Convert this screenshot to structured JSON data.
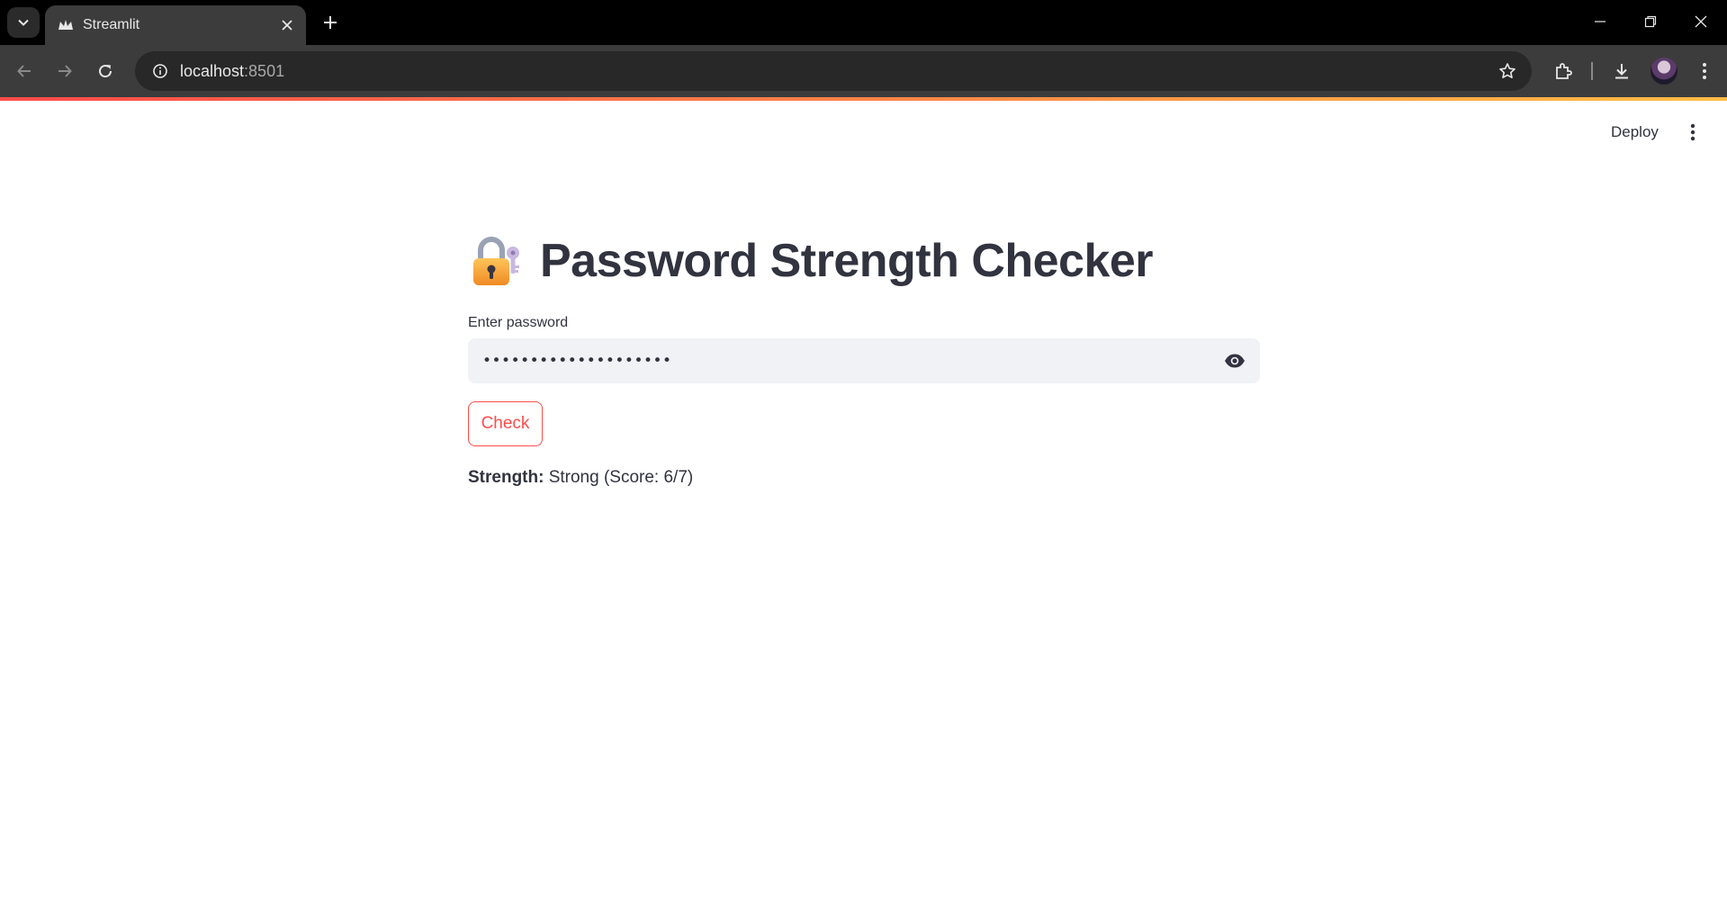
{
  "browser": {
    "tab_title": "Streamlit",
    "url_host": "localhost",
    "url_port": ":8501"
  },
  "icons": {
    "tab_search": "chevron-down-icon",
    "favicon": "streamlit-crown-icon",
    "tab_close": "close-icon",
    "new_tab": "plus-icon",
    "back": "arrow-left-icon",
    "forward": "arrow-right-icon",
    "reload": "reload-icon",
    "site_info": "info-icon",
    "bookmark": "star-icon",
    "extensions": "puzzle-icon",
    "downloads": "download-icon",
    "chrome_menu": "kebab-menu-icon",
    "minimize": "minimize-icon",
    "restore": "restore-icon",
    "close_window": "close-icon",
    "eye": "eye-icon",
    "app_menu": "kebab-menu-icon",
    "title_emoji": "locked-with-key-emoji"
  },
  "colors": {
    "accent": "#ff4b4b",
    "gradient_end": "#ffbd45",
    "text": "#31333f",
    "input_bg": "#f0f2f6"
  },
  "header": {
    "deploy_label": "Deploy"
  },
  "app": {
    "title": "Password Strength Checker",
    "input_label": "Enter password",
    "password_mask": "••••••••••••••••••••",
    "check_label": "Check",
    "result_label": "Strength:",
    "result_value": " Strong (Score: 6/7)"
  }
}
